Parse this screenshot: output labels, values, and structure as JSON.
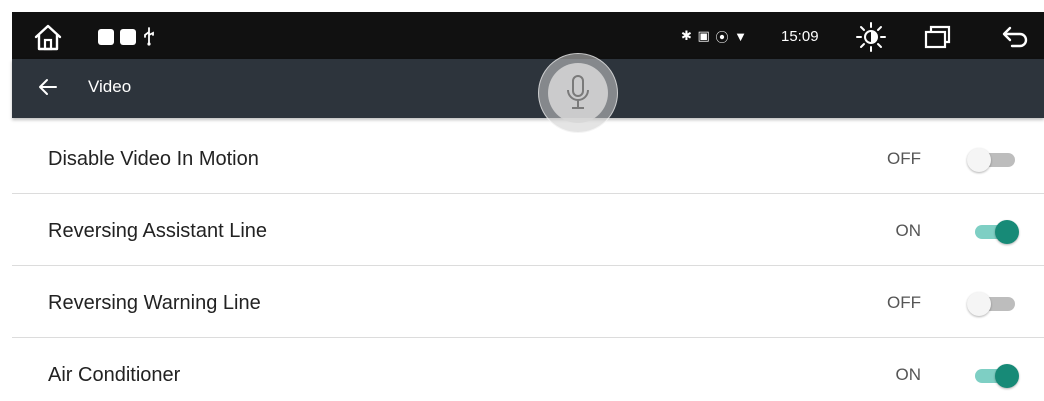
{
  "status_bar": {
    "icons_left": [
      "home-icon",
      "notification-square-icon",
      "notification-square-icon",
      "usb-icon"
    ],
    "icons_right_small": [
      "bluetooth-icon",
      "cast-icon",
      "location-icon",
      "wifi-icon"
    ],
    "time": "15:09",
    "icons_right": [
      "brightness-icon",
      "recent-apps-icon",
      "back-icon"
    ]
  },
  "header": {
    "title": "Video",
    "back_icon": "arrow-left-icon",
    "voice_icon": "microphone-icon",
    "background": "#2d343c"
  },
  "settings": [
    {
      "label": "Disable Video In Motion",
      "state": "OFF",
      "enabled": false
    },
    {
      "label": "Reversing Assistant Line",
      "state": "ON",
      "enabled": true
    },
    {
      "label": "Reversing Warning Line",
      "state": "OFF",
      "enabled": false
    },
    {
      "label": "Air Conditioner",
      "state": "ON",
      "enabled": true
    }
  ],
  "colors": {
    "toggle_on_knob": "#178a77",
    "toggle_on_track": "#7ecfc4",
    "toggle_off_track": "#bdbdbd"
  }
}
